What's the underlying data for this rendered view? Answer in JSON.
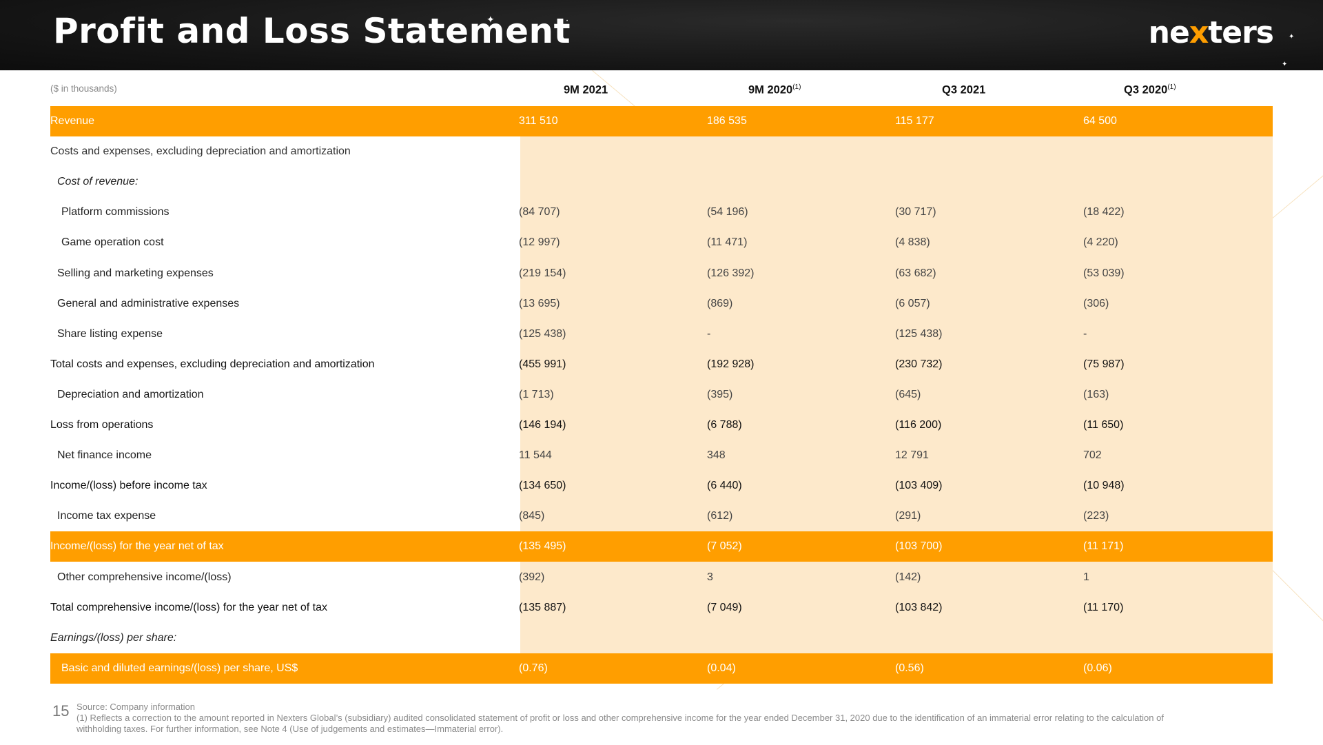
{
  "header": {
    "title": "Profit and Loss Statement",
    "logo_pre": "ne",
    "logo_x": "x",
    "logo_post": "ters"
  },
  "table": {
    "units": "($ in thousands)",
    "columns": [
      {
        "label": "9M 2021",
        "note": ""
      },
      {
        "label": "9M 2020",
        "note": "(1)"
      },
      {
        "label": "Q3 2021",
        "note": ""
      },
      {
        "label": "Q3 2020",
        "note": "(1)"
      }
    ],
    "rows": [
      {
        "label": "Revenue",
        "values": [
          "311 510",
          "186 535",
          "115 177",
          "64 500"
        ]
      },
      {
        "label": "Costs and expenses, excluding depreciation and amortization",
        "values": [
          "",
          "",
          "",
          ""
        ]
      },
      {
        "label": "Cost of revenue:",
        "values": [
          "",
          "",
          "",
          ""
        ]
      },
      {
        "label": "Platform commissions",
        "values": [
          "(84 707)",
          "(54 196)",
          "(30 717)",
          "(18 422)"
        ]
      },
      {
        "label": "Game operation cost",
        "values": [
          "(12 997)",
          "(11 471)",
          "(4 838)",
          "(4 220)"
        ]
      },
      {
        "label": "Selling and marketing expenses",
        "values": [
          "(219 154)",
          "(126 392)",
          "(63 682)",
          "(53 039)"
        ]
      },
      {
        "label": "General and administrative expenses",
        "values": [
          "(13 695)",
          "(869)",
          "(6 057)",
          "(306)"
        ]
      },
      {
        "label": "Share listing expense",
        "values": [
          "(125 438)",
          "-",
          "(125 438)",
          "-"
        ]
      },
      {
        "label": "Total costs and expenses, excluding depreciation and amortization",
        "values": [
          "(455 991)",
          "(192 928)",
          "(230 732)",
          "(75 987)"
        ]
      },
      {
        "label": "Depreciation and amortization",
        "values": [
          "(1 713)",
          "(395)",
          "(645)",
          "(163)"
        ]
      },
      {
        "label": "Loss from operations",
        "values": [
          "(146 194)",
          "(6 788)",
          "(116 200)",
          "(11 650)"
        ]
      },
      {
        "label": "Net finance income",
        "values": [
          "11 544",
          "348",
          "12 791",
          "702"
        ]
      },
      {
        "label": "Income/(loss) before income tax",
        "values": [
          "(134 650)",
          "(6 440)",
          "(103 409)",
          "(10 948)"
        ]
      },
      {
        "label": "Income tax expense",
        "values": [
          "(845)",
          "(612)",
          "(291)",
          "(223)"
        ]
      },
      {
        "label": "Income/(loss) for the year net of tax",
        "values": [
          "(135 495)",
          "(7 052)",
          "(103 700)",
          "(11 171)"
        ]
      },
      {
        "label": "Other comprehensive income/(loss)",
        "values": [
          "(392)",
          "3",
          "(142)",
          "1"
        ]
      },
      {
        "label": "Total comprehensive income/(loss) for the year net of tax",
        "values": [
          "(135 887)",
          "(7 049)",
          "(103 842)",
          "(11 170)"
        ]
      },
      {
        "label": "Earnings/(loss) per share:",
        "values": [
          "",
          "",
          "",
          ""
        ]
      },
      {
        "label": "Basic and diluted earnings/(loss) per share, US$",
        "values": [
          "(0.76)",
          "(0.04)",
          "(0.56)",
          "(0.06)"
        ]
      }
    ]
  },
  "footer": {
    "page_number": "15",
    "source": "Source: Company information",
    "note": "(1) Reflects a correction to the amount reported in Nexters Global’s (subsidiary) audited consolidated statement of profit or loss and other comprehensive income for the year ended December 31, 2020 due to the identification of an immaterial error relating to the calculation of withholding taxes. For further information, see Note 4 (Use of judgements and estimates—Immaterial error)."
  },
  "colors": {
    "accent": "#ff9e00",
    "shade": "#fde9cb",
    "header_bg": "#141414"
  }
}
